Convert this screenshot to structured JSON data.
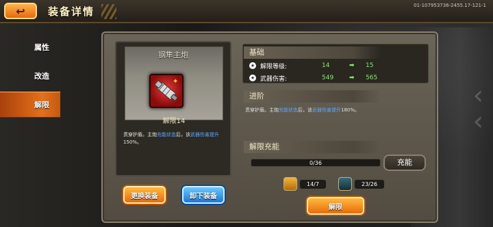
{
  "header": {
    "back_glyph": "↩",
    "title": "装备详情",
    "build_id": "01-107953736-2455.17-121-1"
  },
  "sidebar": {
    "items": [
      {
        "label": "属性",
        "active": false
      },
      {
        "label": "改造",
        "active": false
      },
      {
        "label": "解限",
        "active": true
      }
    ]
  },
  "item_card": {
    "name": "钢隼主炮",
    "level": "解限14",
    "desc_parts": [
      "贯穿护盾。主炮",
      "充能状态",
      "后，该",
      "武器伤害提升",
      "150%。"
    ],
    "buttons": {
      "change": "更换装备",
      "unequip": "卸下装备"
    },
    "icon": "cannon-icon"
  },
  "basics": {
    "header": "基础",
    "rows": [
      {
        "label": "解限等级:",
        "current": "14",
        "next": "15"
      },
      {
        "label": "武器伤害:",
        "current": "549",
        "next": "565"
      }
    ]
  },
  "advance": {
    "header": "进阶",
    "desc_parts": [
      "贯穿护盾。主炮",
      "充能状态",
      "后，该",
      "武器伤害提升",
      "180%。"
    ]
  },
  "charge": {
    "header": "解限充能",
    "progress": "0/36",
    "button_label": "充能"
  },
  "resources": [
    {
      "icon": "wrench-icon",
      "value": "14/7"
    },
    {
      "icon": "part-icon",
      "value": "23/26"
    }
  ],
  "unlock_button": "解限",
  "colors": {
    "accent_orange": "#ea6b0c",
    "accent_blue": "#1a78d8",
    "stat_green": "#7ff06a",
    "highlight_blue": "#5aa7ff"
  }
}
